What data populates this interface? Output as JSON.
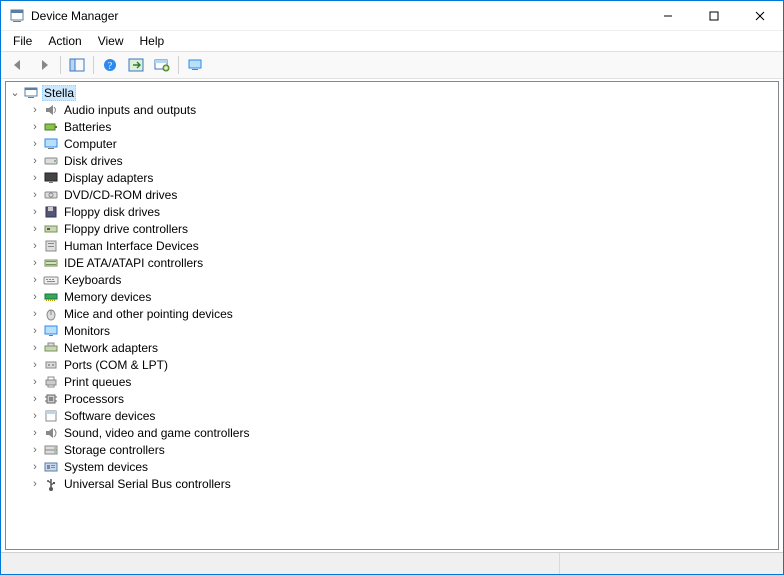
{
  "title": "Device Manager",
  "menus": [
    "File",
    "Action",
    "View",
    "Help"
  ],
  "toolbar_icons": [
    "back",
    "forward",
    "sep",
    "show-hide-console-tree",
    "sep",
    "help",
    "action",
    "scan-hardware",
    "sep",
    "monitor"
  ],
  "root": {
    "label": "Stella",
    "expanded": true,
    "selected": true
  },
  "children": [
    {
      "icon": "audio",
      "label": "Audio inputs and outputs"
    },
    {
      "icon": "battery",
      "label": "Batteries"
    },
    {
      "icon": "computer",
      "label": "Computer"
    },
    {
      "icon": "disk",
      "label": "Disk drives"
    },
    {
      "icon": "display",
      "label": "Display adapters"
    },
    {
      "icon": "dvd",
      "label": "DVD/CD-ROM drives"
    },
    {
      "icon": "floppy",
      "label": "Floppy disk drives"
    },
    {
      "icon": "floppyctrl",
      "label": "Floppy drive controllers"
    },
    {
      "icon": "hid",
      "label": "Human Interface Devices"
    },
    {
      "icon": "ide",
      "label": "IDE ATA/ATAPI controllers"
    },
    {
      "icon": "keyboard",
      "label": "Keyboards"
    },
    {
      "icon": "memory",
      "label": "Memory devices"
    },
    {
      "icon": "mouse",
      "label": "Mice and other pointing devices"
    },
    {
      "icon": "monitor",
      "label": "Monitors"
    },
    {
      "icon": "network",
      "label": "Network adapters"
    },
    {
      "icon": "port",
      "label": "Ports (COM & LPT)"
    },
    {
      "icon": "printer",
      "label": "Print queues"
    },
    {
      "icon": "cpu",
      "label": "Processors"
    },
    {
      "icon": "software",
      "label": "Software devices"
    },
    {
      "icon": "sound",
      "label": "Sound, video and game controllers"
    },
    {
      "icon": "storage",
      "label": "Storage controllers"
    },
    {
      "icon": "system",
      "label": "System devices"
    },
    {
      "icon": "usb",
      "label": "Universal Serial Bus controllers"
    }
  ]
}
